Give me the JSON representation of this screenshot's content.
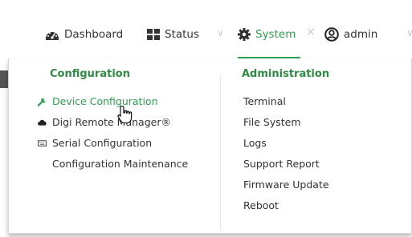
{
  "nav": {
    "items": [
      {
        "label": "Dashboard",
        "icon": "dashboard-gauge-icon"
      },
      {
        "label": "Status",
        "icon": "grid-icon"
      },
      {
        "label": "System",
        "icon": "gear-icon",
        "active": true
      },
      {
        "label": "admin",
        "icon": "user-circle-icon"
      }
    ],
    "separator": "∨",
    "close_glyph": "×",
    "accent_color": "#2e9e4f"
  },
  "menu": {
    "configuration": {
      "title": "Configuration",
      "items": [
        {
          "label": "Device Configuration",
          "icon": "wrench-icon"
        },
        {
          "label": "Digi Remote Manager®",
          "icon": "cloud-icon"
        },
        {
          "label": "Serial Configuration",
          "icon": "keyboard-icon"
        },
        {
          "label": "Configuration Maintenance"
        }
      ]
    },
    "administration": {
      "title": "Administration",
      "items": [
        {
          "label": "Terminal"
        },
        {
          "label": "File System"
        },
        {
          "label": "Logs"
        },
        {
          "label": "Support Report"
        },
        {
          "label": "Firmware Update"
        },
        {
          "label": "Reboot"
        }
      ]
    }
  }
}
